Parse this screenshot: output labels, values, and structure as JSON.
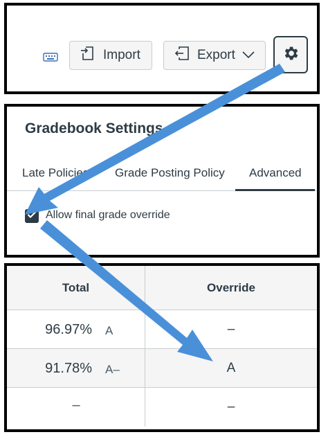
{
  "toolbar": {
    "keyboard_icon": "keyboard-icon",
    "import_label": "Import",
    "import_icon": "import-icon",
    "export_label": "Export",
    "export_icon": "export-icon",
    "export_chevron_icon": "chevron-down-icon",
    "settings_icon": "gear-icon"
  },
  "settings": {
    "title": "Gradebook Settings",
    "tabs": [
      {
        "label": "Late Policies"
      },
      {
        "label": "Grade Posting Policy"
      },
      {
        "label": "Advanced",
        "selected": true
      }
    ],
    "allow_final_grade_override": {
      "label": "Allow final grade override",
      "checked": true
    }
  },
  "grades": {
    "headers": {
      "total": "Total",
      "override": "Override"
    },
    "rows": [
      {
        "total": "96.97%",
        "letter": "A",
        "override": "–"
      },
      {
        "total": "91.78%",
        "letter": "A–",
        "override": "A"
      },
      {
        "total": "–",
        "letter": "",
        "override": "–"
      }
    ]
  },
  "colors": {
    "arrow": "#4a90d9",
    "text": "#2d3b45",
    "border": "#c7cdd1",
    "panel_border": "#000000"
  }
}
